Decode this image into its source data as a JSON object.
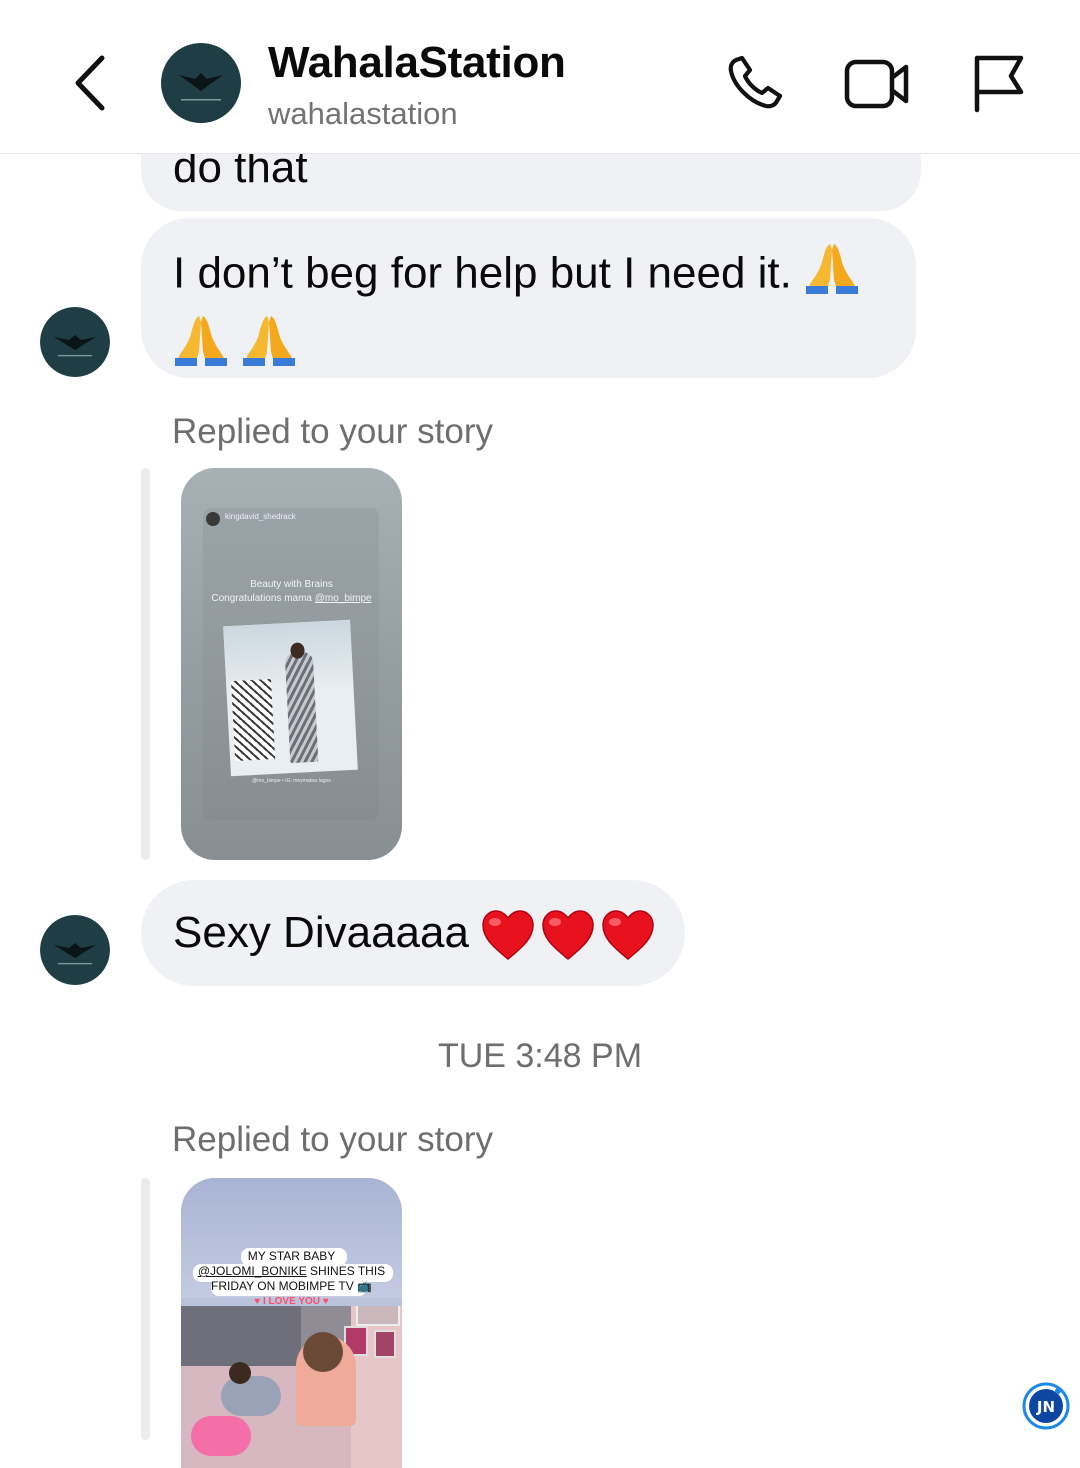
{
  "header": {
    "title": "WahalaStation",
    "username": "wahalastation"
  },
  "messages": {
    "partial_text": "do that",
    "msg1_text": "I don’t beg for help but I need it.",
    "reply1_label": "Replied to your story",
    "story1": {
      "user": "kingdavid_shedrack",
      "line1": "Beauty with Brains",
      "line2": "Congratulations mama",
      "mention": "@mo_bimpe",
      "caption": "@mo_bimpe • IG: meymakes lagos"
    },
    "msg2_text": "Sexy Divaaaaa",
    "msg2_emoji": "❤️❤️❤️",
    "timestamp": "TUE 3:48 PM",
    "reply2_label": "Replied to your story",
    "story2": {
      "line1": "MY STAR BABY",
      "mention": "@JOLOMI_BONIKE",
      "line2_rest": " SHINES THIS",
      "line3": "FRIDAY ON MOBIMPE TV 📺",
      "banner": "♥ I LOVE YOU ♥"
    }
  },
  "watermark": "JN",
  "colors": {
    "bubble": "#eff1f4",
    "meta_gray": "#737373"
  },
  "icons": [
    "back-chevron-icon",
    "phone-icon",
    "video-icon",
    "flag-icon",
    "heart-icon",
    "praying-hands-icon"
  ]
}
